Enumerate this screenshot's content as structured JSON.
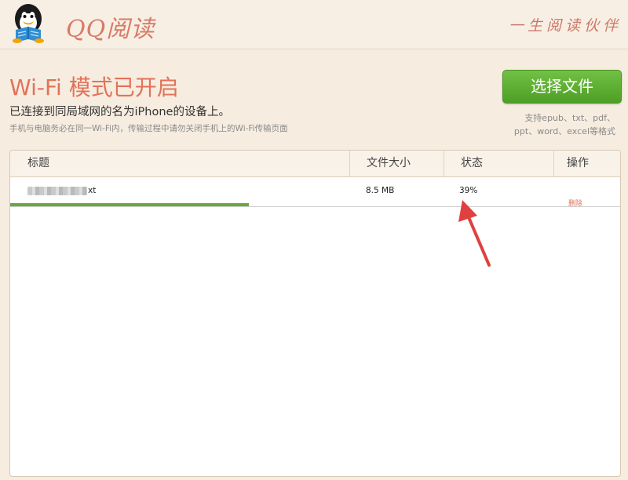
{
  "header": {
    "app_name": "QQ阅读",
    "slogan": "一生阅读伙伴"
  },
  "intro": {
    "mode_title": "Wi-Fi 模式已开启",
    "connected_text": "已连接到同局域网的名为iPhone的设备上。",
    "hint_text": "手机与电脑务必在同一Wi-Fi内，传输过程中请勿关闭手机上的Wi-Fi传输页面",
    "select_button": "选择文件",
    "formats_line1": "支持epub、txt、pdf、",
    "formats_line2": "ppt、word、excel等格式"
  },
  "table": {
    "columns": [
      "标题",
      "文件大小",
      "状态",
      "操作"
    ],
    "rows": [
      {
        "title_suffix": "xt",
        "size": "8.5 MB",
        "status": "39%",
        "progress": 0.39,
        "action": "删除"
      }
    ]
  },
  "colors": {
    "accent": "#e2725a",
    "button_green": "#5cad31",
    "progress_green": "#6aa83d",
    "arrow_red": "#e04040"
  }
}
